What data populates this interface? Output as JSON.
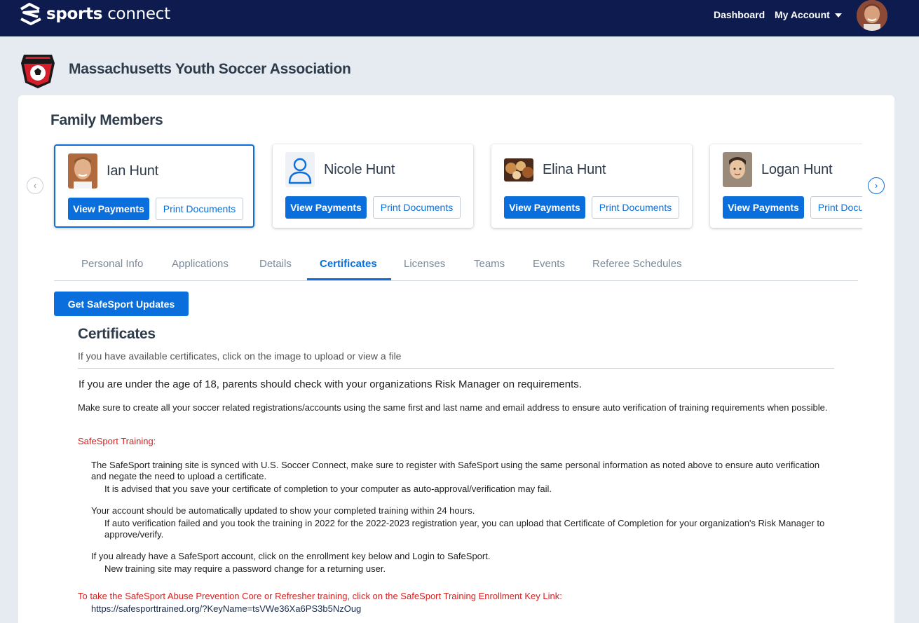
{
  "nav": {
    "logo_bold": "sports",
    "logo_light": " connect",
    "dashboard": "Dashboard",
    "my_account": "My Account"
  },
  "org": {
    "name": "Massachusetts Youth Soccer Association"
  },
  "family": {
    "title": "Family Members",
    "members": [
      {
        "name": "Ian Hunt",
        "view_payments": "View Payments",
        "print_documents": "Print Documents",
        "active": true
      },
      {
        "name": "Nicole Hunt",
        "view_payments": "View Payments",
        "print_documents": "Print Documents",
        "active": false
      },
      {
        "name": "Elina Hunt",
        "view_payments": "View Payments",
        "print_documents": "Print Documents",
        "active": false
      },
      {
        "name": "Logan Hunt",
        "view_payments": "View Payments",
        "print_documents": "Print Documents",
        "active": false
      }
    ]
  },
  "tabs": [
    {
      "label": "Personal Info"
    },
    {
      "label": "Applications"
    },
    {
      "label": "Details"
    },
    {
      "label": "Certificates",
      "active": true
    },
    {
      "label": "Licenses"
    },
    {
      "label": "Teams"
    },
    {
      "label": "Events"
    },
    {
      "label": "Referee Schedules"
    }
  ],
  "safesport_button": "Get SafeSport Updates",
  "certificates": {
    "title": "Certificates",
    "subtitle": "If you have available certificates, click on the image to upload or view a file",
    "age_notice": "If you are under the age of 18, parents should check with your organizations Risk Manager on requirements.",
    "make_sure": "Make sure to create all your soccer related registrations/accounts using the same first and last name and email address to ensure auto verification of training requirements when possible.",
    "safesport_label": "SafeSport Training:",
    "p1": "The SafeSport training site is synced with U.S. Soccer Connect, make sure to register with SafeSport using the same personal information as noted above to ensure auto verification and negate the need to upload a certificate.",
    "p1_sub": "It is advised that you save your certificate of completion to your computer as auto-approval/verification may fail.",
    "p2": "Your account should be automatically updated to show your completed training within 24 hours.",
    "p2_sub": "If auto verification failed and you took the training in 2022 for the 2022-2023 registration year, you can upload that Certificate of Completion for your organization's Risk Manager to approve/verify.",
    "p3": "If you already have a SafeSport account, click on the enrollment key below and Login to SafeSport.",
    "p3_sub": "New training site may require a password change for a returning user.",
    "enroll_text": "To take the SafeSport Abuse Prevention Core or Refresher training, click on the SafeSport Training Enrollment Key Link:",
    "enroll_link": "https://safesporttrained.org/?KeyName=tsVWe36Xa6PS3b5NzOug"
  },
  "colors": {
    "nav_bg": "#0d1b4f",
    "primary": "#0a6fdc",
    "alert_red": "#d62020",
    "page_bg": "#e6ebf2"
  }
}
